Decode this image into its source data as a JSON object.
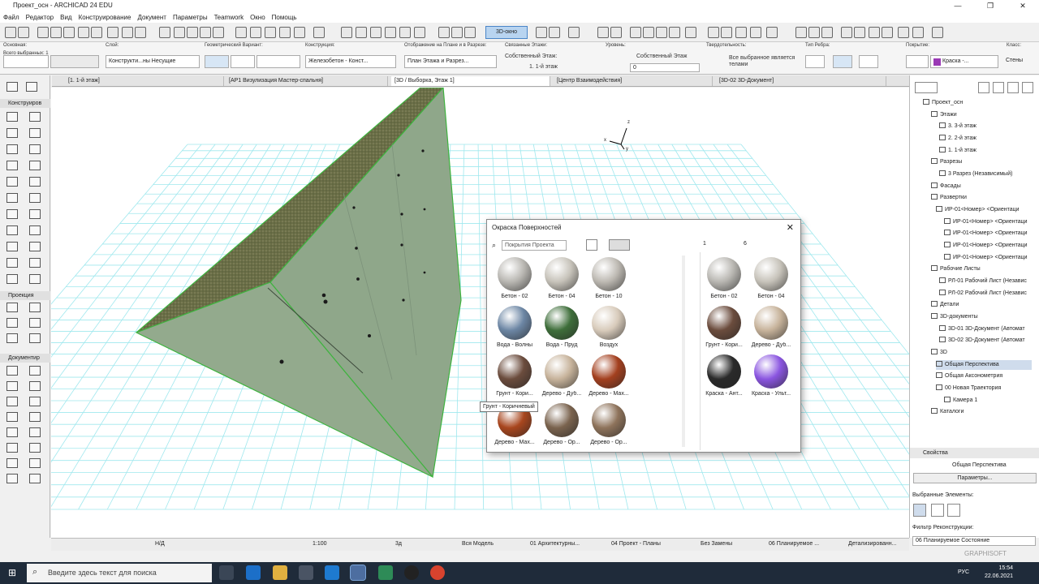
{
  "window": {
    "title": "Проект_осн - ARCHICAD 24 EDU",
    "controls": [
      "—",
      "❐",
      "✕"
    ]
  },
  "menu": [
    "Файл",
    "Редактор",
    "Вид",
    "Конструирование",
    "Документ",
    "Параметры",
    "Teamwork",
    "Окно",
    "Помощь"
  ],
  "toolbar": {
    "view3d_label": "3D-окно"
  },
  "infobox": {
    "basic_label": "Основная:",
    "all_selected": "Всего выбранных: 1",
    "layer_label": "Слой:",
    "layer_value": "Конструкти...ны Несущие",
    "geom_label": "Геометрический Вариант:",
    "construction_label": "Конструкция:",
    "construction_value": "Железобетон - Конст...",
    "display_label": "Отображение на Плане и в Разрезе:",
    "display_value": "План Этажа и Разрез...",
    "linked_floors_label": "Связанные Этажи:",
    "own_floor": "Собственный Этаж:",
    "floor_value": "1. 1-й этаж",
    "level_label": "Уровень:",
    "level_own": "Собственный Этаж",
    "level_value": "0",
    "solid_label": "Твердотельность:",
    "solid_value": "Все выбранное является телами",
    "rib_label": "Тип Ребра:",
    "cover_label": "Покрытие:",
    "cover_value": "Краска -...",
    "class_label": "Класс:",
    "class_value": "Стены"
  },
  "tabs": [
    "[1. 1-й этаж]",
    "[АР1 Визулизация Мастер-спальня]",
    "[3D / Выборка, Этаж 1]",
    "[Центр Взаимодействия]",
    "[3D-02 3D-Документ]"
  ],
  "lefttools": {
    "sections": [
      "Конструиров",
      "Проекция",
      "Документир"
    ]
  },
  "dialog": {
    "title": "Окраска Поверхностей",
    "search_placeholder": "Покрытия Проекта",
    "count1": "1",
    "count6": "6",
    "materials": [
      {
        "name": "Бетон - 02",
        "color": "#b9b7b2"
      },
      {
        "name": "Бетон - 04",
        "color": "#c7c3ba"
      },
      {
        "name": "Бетон - 10",
        "color": "#bdb9b2"
      },
      {
        "name": "Вода - Волны",
        "color": "#6c86a4"
      },
      {
        "name": "Вода - Пруд",
        "color": "#3e6e3a"
      },
      {
        "name": "Воздух",
        "color": "#d8cbbb"
      },
      {
        "name": "Грунт - Кори...",
        "color": "#6b4c3d"
      },
      {
        "name": "Дерево - Дуб...",
        "color": "#c7b39b"
      },
      {
        "name": "Дерево - Мах...",
        "color": "#a3401f"
      },
      {
        "name": "Дерево - Мах...",
        "color": "#a8461e"
      },
      {
        "name": "Дерево - Ор...",
        "color": "#7a634e"
      },
      {
        "name": "Дерево - Ор...",
        "color": "#8e735b"
      }
    ],
    "used": [
      {
        "name": "Бетон - 02",
        "color": "#b9b7b2"
      },
      {
        "name": "Бетон - 04",
        "color": "#c7c3ba"
      },
      {
        "name": "Грунт - Кори...",
        "color": "#6b4c3d"
      },
      {
        "name": "Дерево - Дуб...",
        "color": "#c7b39b"
      },
      {
        "name": "Краска - Ант...",
        "color": "#2a2a2a"
      },
      {
        "name": "Краска - Ульт...",
        "color": "#8a55e0"
      }
    ],
    "tooltip": "Грунт - Коричневый"
  },
  "tree": {
    "root": "Проект_осн",
    "floors": "Этажи",
    "f3": "3. 3-й этаж",
    "f2": "2. 2-й этаж",
    "f1": "1. 1-й этаж",
    "sections": "Разрезы",
    "sec3": "3 Разрез (Независимый)",
    "facades": "Фасады",
    "unfold": "Развертки",
    "ir01": "ИР-01<Номер> <Ориентаци",
    "ir01a": "ИР-01<Номер> <Ориентаци",
    "ir01b": "ИР-01<Номер> <Ориентаци",
    "ir01c": "ИР-01<Номер> <Ориентаци",
    "ir01d": "ИР-01<Номер> <Ориентаци",
    "worksheets": "Рабочие Листы",
    "rl01": "РЛ-01 Рабочий Лист (Независ",
    "rl02": "РЛ-02 Рабочий Лист (Независ",
    "details": "Детали",
    "docs3d": "3D-документы",
    "d1": "3D-01 3D-Документ (Автомат",
    "d2": "3D-02 3D-Документ (Автомат",
    "v3d": "3D",
    "persp": "Общая Перспектива",
    "axo": "Общая Аксонометрия",
    "traj": "00 Новая Траектория",
    "cam": "Камера 1",
    "catalogs": "Каталоги"
  },
  "props": {
    "header": "Свойства",
    "name": "Общая Перспектива",
    "params": "Параметры...",
    "selected": "Выбранные Элементы:",
    "filter": "Фильтр Реконструкции:",
    "filter_value": "06 Планируемое Состояние",
    "brand": "GRAPHISOFT"
  },
  "status": {
    "nd1": "Н/Д",
    "scale": "1:100",
    "mode": "3д",
    "model": "Вся Модель",
    "layers": "01 Архитектурны...",
    "proj": "04 Проект - Планы",
    "overrides": "Без Замены",
    "plan": "06 Планируемое ...",
    "detail": "Детализированн..."
  },
  "taskbar": {
    "search": "Введите здесь текст для поиска",
    "time": "15:54",
    "date": "22.06.2021",
    "lang": "РУС"
  },
  "axes": {
    "x": "x",
    "y": "y",
    "z": "z"
  }
}
